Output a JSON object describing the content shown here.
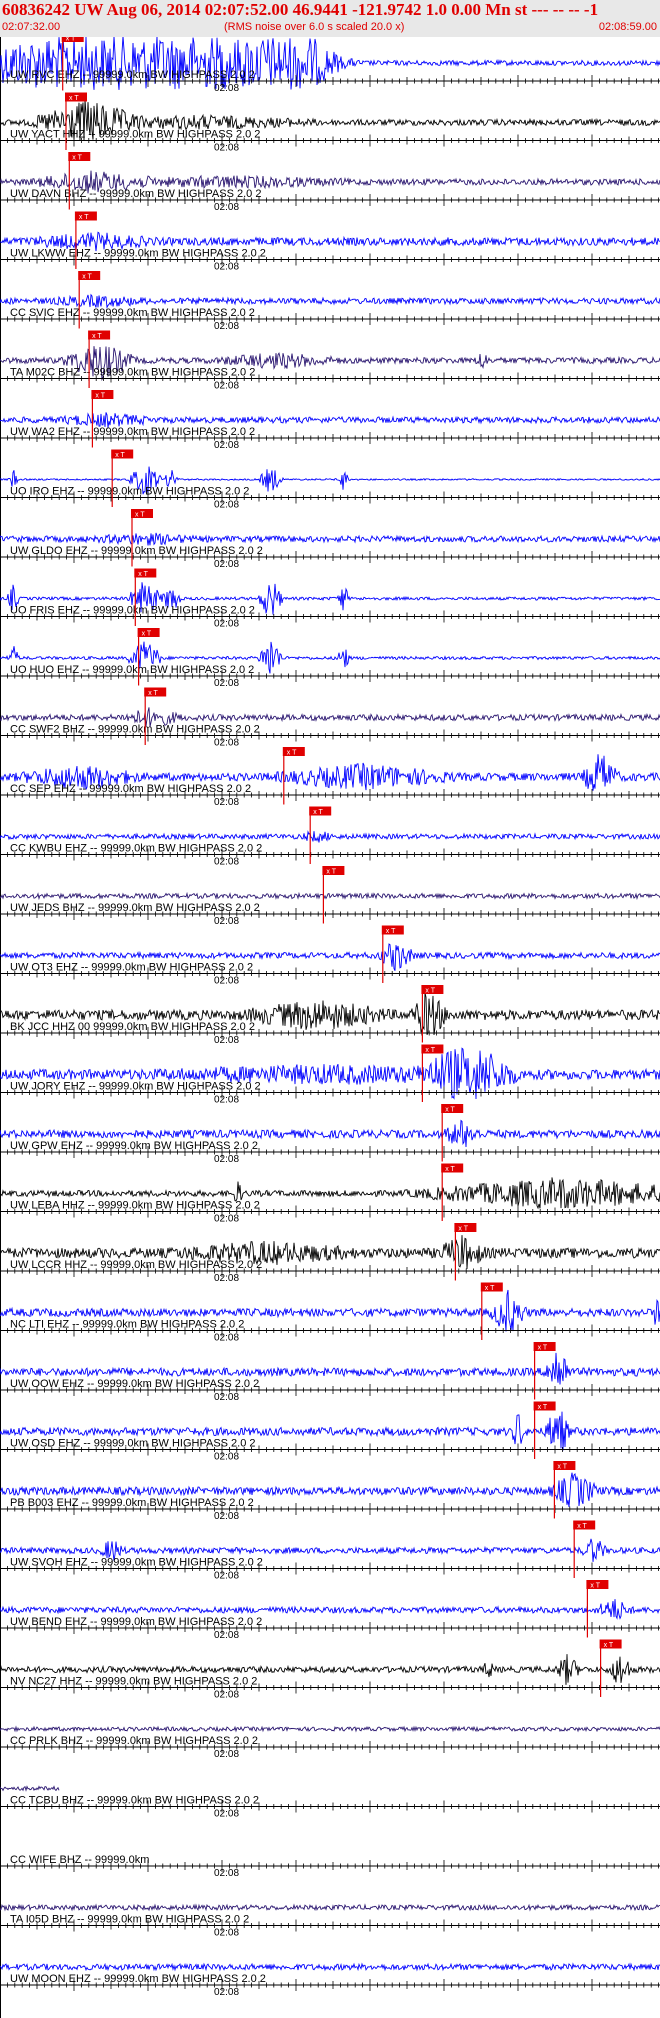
{
  "header": {
    "title": "60836242 UW Aug 06, 2014 02:07:52.00   46.9441 -121.9742  1.0 0.00 Mn st --- -- --  -1",
    "start_time": "02:07:32.00",
    "end_time": "02:08:59.00",
    "rms_note": "(RMS noise over 6.0 s scaled 20.0 x)"
  },
  "minute_label": "02:08",
  "pick_label": "x T",
  "colors": {
    "background": "#ffffff",
    "header_bg": "#e8e8e8",
    "title": "#e00000",
    "pick": "#e00000",
    "axis": "#000000",
    "trace_blue": "#0000ff",
    "trace_black": "#000000",
    "trace_purple": "#2a1670"
  },
  "traces": [
    {
      "label": "UW RVC EHZ -- 99999.0km BW  HIGHPASS  2.0  2",
      "color": "blue",
      "pick": 0.095,
      "events": [
        [
          0.2,
          0.35,
          40
        ],
        [
          0.12,
          0.05,
          30
        ],
        [
          0.44,
          0.08,
          25
        ]
      ],
      "noise": 2.5
    },
    {
      "label": "UW YACT HHZ -- 99999.0km BW  HIGHPASS  2.0  2",
      "color": "black",
      "pick": 0.1,
      "events": [
        [
          0.13,
          0.09,
          20
        ],
        [
          0.3,
          0.2,
          5
        ]
      ],
      "noise": 3
    },
    {
      "label": "UW DAVN BHZ -- 99999.0km BW  HIGHPASS  2.0  2",
      "color": "purple",
      "pick": 0.105,
      "events": [
        [
          0.14,
          0.1,
          9
        ],
        [
          0.35,
          0.2,
          4
        ]
      ],
      "noise": 3
    },
    {
      "label": "UW LKWW EHZ -- 99999.0km BW  HIGHPASS  2.0  2",
      "color": "blue",
      "pick": 0.115,
      "events": [
        [
          0.14,
          0.1,
          6
        ]
      ],
      "noise": 4
    },
    {
      "label": "CC SVIC EHZ -- 99999.0km BW  HIGHPASS  2.0  2",
      "color": "blue",
      "pick": 0.12,
      "events": [
        [
          0.15,
          0.08,
          4
        ]
      ],
      "noise": 3
    },
    {
      "label": "TA M02C BHZ -- 99999.0km BW  HIGHPASS  2.0  2",
      "color": "purple",
      "pick": 0.135,
      "events": [
        [
          0.15,
          0.06,
          18
        ],
        [
          0.42,
          0.1,
          6
        ],
        [
          0.73,
          0.01,
          10
        ]
      ],
      "noise": 3
    },
    {
      "label": "UW WA2 EHZ -- 99999.0km BW  HIGHPASS  2.0  2",
      "color": "blue",
      "pick": 0.14,
      "events": [
        [
          0.16,
          0.08,
          5
        ]
      ],
      "noise": 3
    },
    {
      "label": "UO IRO EHZ -- 99999.0km BW  HIGHPASS  2.0  2",
      "color": "blue",
      "pick": 0.17,
      "events": [
        [
          0.02,
          0.008,
          10
        ],
        [
          0.22,
          0.03,
          16
        ],
        [
          0.26,
          0.012,
          12
        ],
        [
          0.41,
          0.02,
          14
        ],
        [
          0.52,
          0.012,
          10
        ]
      ],
      "noise": 0.8
    },
    {
      "label": "UW GLDO EHZ -- 99999.0km BW  HIGHPASS  2.0  2",
      "color": "blue",
      "pick": 0.2,
      "events": [
        [
          0.22,
          0.08,
          4
        ]
      ],
      "noise": 3
    },
    {
      "label": "UO FRIS EHZ -- 99999.0km BW  HIGHPASS  2.0  2",
      "color": "blue",
      "pick": 0.205,
      "events": [
        [
          0.02,
          0.01,
          14
        ],
        [
          0.22,
          0.03,
          18
        ],
        [
          0.26,
          0.015,
          16
        ],
        [
          0.41,
          0.02,
          22
        ],
        [
          0.52,
          0.01,
          14
        ]
      ],
      "noise": 1.5
    },
    {
      "label": "UO HUO EHZ -- 99999.0km BW  HIGHPASS  2.0  2",
      "color": "blue",
      "pick": 0.21,
      "events": [
        [
          0.02,
          0.01,
          12
        ],
        [
          0.22,
          0.03,
          18
        ],
        [
          0.41,
          0.02,
          22
        ],
        [
          0.52,
          0.01,
          16
        ]
      ],
      "noise": 1.5
    },
    {
      "label": "CC SWF2 BHZ -- 99999.0km BW  HIGHPASS  2.0  2",
      "color": "purple",
      "pick": 0.22,
      "events": [
        [
          0.23,
          0.05,
          8
        ]
      ],
      "noise": 3
    },
    {
      "label": "CC SEP EHZ -- 99999.0km BW  HIGHPASS  2.0  2",
      "color": "blue",
      "pick": 0.43,
      "events": [
        [
          0.12,
          0.1,
          10
        ],
        [
          0.55,
          0.15,
          10
        ],
        [
          0.91,
          0.03,
          22
        ]
      ],
      "noise": 4
    },
    {
      "label": "CC KWBU EHZ -- 99999.0km BW  HIGHPASS  2.0  2",
      "color": "blue",
      "pick": 0.47,
      "events": [
        [
          0.48,
          0.03,
          4
        ]
      ],
      "noise": 2.5
    },
    {
      "label": "UW JEDS BHZ -- 99999.0km BW  HIGHPASS  2.0  2",
      "color": "purple",
      "pick": 0.49,
      "events": [],
      "noise": 2.5
    },
    {
      "label": "UW OT3 EHZ -- 99999.0km BW  HIGHPASS  2.0  2",
      "color": "blue",
      "pick": 0.58,
      "events": [
        [
          0.6,
          0.03,
          14
        ]
      ],
      "noise": 3
    },
    {
      "label": "BK JCC HHZ 00 99999.0km BW  HIGHPASS  2.0  2",
      "color": "black",
      "pick": 0.64,
      "events": [
        [
          0.48,
          0.12,
          12
        ],
        [
          0.65,
          0.03,
          22
        ]
      ],
      "noise": 5
    },
    {
      "label": "UW JORY EHZ -- 99999.0km BW  HIGHPASS  2.0  2",
      "color": "blue",
      "pick": 0.64,
      "events": [
        [
          0.71,
          0.08,
          28
        ],
        [
          0.5,
          0.3,
          6
        ]
      ],
      "noise": 5
    },
    {
      "label": "UW GPW EHZ -- 99999.0km BW  HIGHPASS  2.0  2",
      "color": "blue",
      "pick": 0.67,
      "events": [
        [
          0.7,
          0.03,
          12
        ]
      ],
      "noise": 4
    },
    {
      "label": "UW LEBA HHZ -- 99999.0km BW  HIGHPASS  2.0  2",
      "color": "black",
      "pick": 0.67,
      "events": [
        [
          0.36,
          0.01,
          10
        ],
        [
          0.85,
          0.25,
          14
        ]
      ],
      "noise": 3
    },
    {
      "label": "UW LCCR HHZ -- 99999.0km BW  HIGHPASS  2.0  2",
      "color": "black",
      "pick": 0.69,
      "events": [
        [
          0.4,
          0.15,
          8
        ],
        [
          0.7,
          0.04,
          14
        ]
      ],
      "noise": 5
    },
    {
      "label": "NC LTI EHZ -- 99999.0km BW  HIGHPASS  2.0  2",
      "color": "blue",
      "pick": 0.73,
      "events": [
        [
          0.77,
          0.03,
          20
        ],
        [
          0.995,
          0.005,
          20
        ]
      ],
      "noise": 4
    },
    {
      "label": "UW OOW EHZ -- 99999.0km BW  HIGHPASS  2.0  2",
      "color": "blue",
      "pick": 0.81,
      "events": [
        [
          0.845,
          0.02,
          28
        ]
      ],
      "noise": 4
    },
    {
      "label": "UW OSD EHZ -- 99999.0km BW  HIGHPASS  2.0  2",
      "color": "blue",
      "pick": 0.81,
      "events": [
        [
          0.785,
          0.01,
          20
        ],
        [
          0.845,
          0.02,
          26
        ]
      ],
      "noise": 4
    },
    {
      "label": "PB B003 EHZ -- 99999.0km BW  HIGHPASS  2.0  2",
      "color": "blue",
      "pick": 0.84,
      "events": [
        [
          0.87,
          0.04,
          16
        ]
      ],
      "noise": 4
    },
    {
      "label": "UW SVOH EHZ -- 99999.0km BW  HIGHPASS  2.0  2",
      "color": "blue",
      "pick": 0.87,
      "events": [
        [
          0.17,
          0.02,
          10
        ],
        [
          0.9,
          0.02,
          12
        ]
      ],
      "noise": 3
    },
    {
      "label": "UW BEND EHZ -- 99999.0km BW  HIGHPASS  2.0  2",
      "color": "blue",
      "pick": 0.89,
      "events": [
        [
          0.93,
          0.03,
          10
        ]
      ],
      "noise": 3
    },
    {
      "label": "NV NC27 HHZ -- 99999.0km BW  HIGHPASS  2.0  2",
      "color": "black",
      "pick": 0.91,
      "events": [
        [
          0.74,
          0.01,
          8
        ],
        [
          0.86,
          0.02,
          14
        ],
        [
          0.94,
          0.02,
          16
        ]
      ],
      "noise": 3
    },
    {
      "label": "CC PRLK BHZ -- 99999.0km BW  HIGHPASS  2.0  2",
      "color": "purple",
      "pick": null,
      "events": [],
      "noise": 2
    },
    {
      "label": "CC TCBU BHZ -- 99999.0km BW  HIGHPASS  2.0  2",
      "color": "purple",
      "pick": null,
      "events": [],
      "noise": 2,
      "end_frac": 0.09
    },
    {
      "label": "CC WIFE BHZ -- 99999.0km",
      "color": "none",
      "pick": null,
      "events": [],
      "noise": 0
    },
    {
      "label": "TA I05D BHZ -- 99999.0km BW  HIGHPASS  2.0  2",
      "color": "purple",
      "pick": null,
      "events": [],
      "noise": 2.5
    },
    {
      "label": "UW MOON EHZ -- 99999.0km BW  HIGHPASS  2.0  2",
      "color": "blue",
      "pick": null,
      "events": [],
      "noise": 3
    }
  ]
}
